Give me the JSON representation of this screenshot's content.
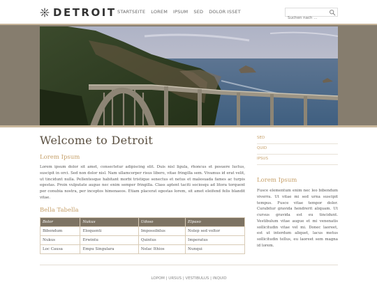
{
  "brand": {
    "name": "DETROIT"
  },
  "nav": {
    "items": [
      "STARTSEITE",
      "LOREM",
      "IPSUM",
      "SED",
      "DOLOR ISSET"
    ]
  },
  "search": {
    "placeholder": "Suchen nach ..."
  },
  "main": {
    "title": "Welcome to Detroit",
    "subheading": "Lorem Ipsum",
    "paragraph": "Lorem ipsum dolor sit amet, consectetur adipiscing elit. Duis nisl ligula, rhoncus et posuere luctus, suscipit in orci. Sed non dolor nisl. Nam ullamcorper risus libero, vitae fringilla sem. Vivamus id erat velit, ut tincidunt nulla. Pellentesque habitant morbi tristique senectus et netus et malesuada fames ac turpis egestas. Proin vulputate augue nec enim semper fringilla. Class aptent taciti sociosqu ad litora torquent per conubia nostra, per inceptos himenaeos. Etiam placerat egestas lorem, sit amet eleifend felis blandit vitae.",
    "table_title": "Bella Tabella",
    "table": {
      "headers": [
        "Bolor",
        "Nukus",
        "Udoso",
        "Elpaso"
      ],
      "rows": [
        [
          "Bibendum",
          "Eloquenti",
          "Impossibilus",
          "Nolep sed voltor"
        ],
        [
          "Nukus",
          "Erwintu",
          "Quintus",
          "Imperatus"
        ],
        [
          "Loc Causa",
          "Empu Singulara",
          "Nelac Ithios",
          "Nunqui"
        ]
      ]
    }
  },
  "sidebar": {
    "links": [
      "SED",
      "QUID",
      "IPSUS"
    ],
    "heading": "Lorem Ipsum",
    "paragraph": "Fusce elementum enim nec leo bibendum viverra. Ut vitae mi sed urna suscipit tempus. Fusce vitae tempor dolor. Curabitur gravida hendrerit aliquam. Ut cursus gravida est eu tincidunt. Vestibulum vitae augue et mi venenatis sollicitudin vitae vel mi. Donec laoreet, est ut interdum aliquet, lacus metus sollicitudin tellus, eu laoreet sem magna id lorem."
  },
  "footer": {
    "links": [
      "LOPOM",
      "URSUS",
      "VESTIBULUS",
      "INQUID"
    ],
    "separator": " | "
  },
  "colors": {
    "accent": "#c6a06a",
    "band": "#867d6e",
    "table_header": "#7d7363"
  },
  "icons": {
    "logo": "sunburst-logo-icon",
    "search": "search-icon"
  }
}
